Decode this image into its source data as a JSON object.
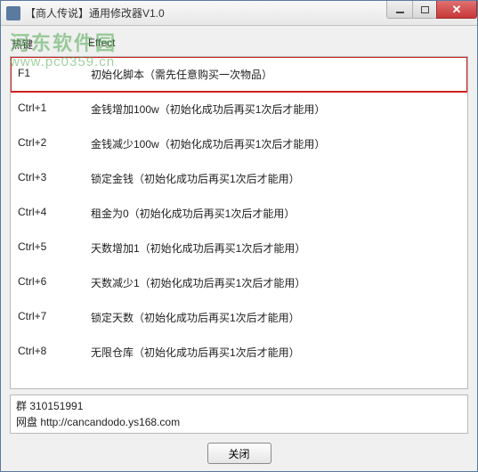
{
  "window": {
    "title": "【商人传说】通用修改器V1.0"
  },
  "watermark": {
    "line1": "河东软件园",
    "line2": "www.pc0359.cn"
  },
  "headers": {
    "hotkey": "热键",
    "effect": "Effect"
  },
  "rows": [
    {
      "hotkey": "F1",
      "effect": "初始化脚本（需先任意购买一次物品）",
      "highlight": true
    },
    {
      "hotkey": "Ctrl+1",
      "effect": "金钱增加100w（初始化成功后再买1次后才能用）",
      "highlight": false
    },
    {
      "hotkey": "Ctrl+2",
      "effect": "金钱减少100w（初始化成功后再买1次后才能用）",
      "highlight": false
    },
    {
      "hotkey": "Ctrl+3",
      "effect": "锁定金钱（初始化成功后再买1次后才能用）",
      "highlight": false
    },
    {
      "hotkey": "Ctrl+4",
      "effect": "租金为0（初始化成功后再买1次后才能用）",
      "highlight": false
    },
    {
      "hotkey": "Ctrl+5",
      "effect": "天数增加1（初始化成功后再买1次后才能用）",
      "highlight": false
    },
    {
      "hotkey": "Ctrl+6",
      "effect": "天数减少1（初始化成功后再买1次后才能用）",
      "highlight": false
    },
    {
      "hotkey": "Ctrl+7",
      "effect": "锁定天数（初始化成功后再买1次后才能用）",
      "highlight": false
    },
    {
      "hotkey": "Ctrl+8",
      "effect": "无限仓库（初始化成功后再买1次后才能用）",
      "highlight": false
    }
  ],
  "info": {
    "line1": "群 310151991",
    "line2": "网盘 http://cancandodo.ys168.com"
  },
  "buttons": {
    "close": "关闭"
  }
}
